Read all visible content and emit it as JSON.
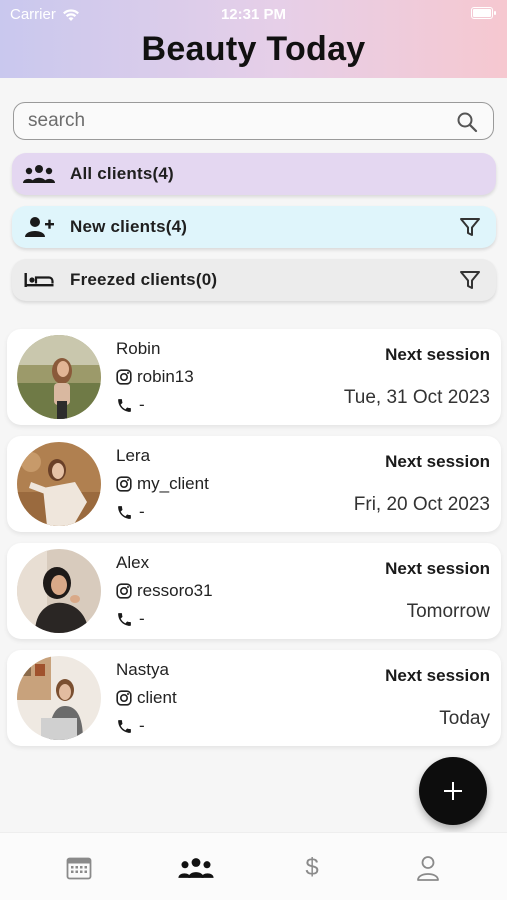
{
  "status_bar": {
    "carrier": "Carrier",
    "time": "12:31 PM"
  },
  "header": {
    "title": "Beauty Today"
  },
  "search": {
    "placeholder": "search",
    "icon": "search-icon"
  },
  "filters": [
    {
      "label": "All clients(4)",
      "icon": "group-icon",
      "has_filter": false,
      "color": "#e4d7f1"
    },
    {
      "label": "New clients(4)",
      "icon": "add-person-icon",
      "has_filter": true,
      "color": "#dff5fb"
    },
    {
      "label": "Freezed clients(0)",
      "icon": "freeze-icon",
      "has_filter": true,
      "color": "#ececec"
    }
  ],
  "clients": [
    {
      "name": "Robin",
      "instagram": "robin13",
      "phone": "-",
      "session_label": "Next session",
      "session_date": "Tue, 31 Oct 2023"
    },
    {
      "name": "Lera",
      "instagram": "my_client",
      "phone": "-",
      "session_label": "Next session",
      "session_date": "Fri, 20 Oct 2023"
    },
    {
      "name": "Alex",
      "instagram": "ressoro31",
      "phone": "-",
      "session_label": "Next session",
      "session_date": "Tomorrow"
    },
    {
      "name": "Nastya",
      "instagram": "client",
      "phone": "-",
      "session_label": "Next session",
      "session_date": "Today"
    }
  ],
  "fab": {
    "label": "+",
    "icon": "plus-icon"
  },
  "tabbar": {
    "items": [
      {
        "icon": "calendar-icon",
        "active": false
      },
      {
        "icon": "clients-icon",
        "active": true
      },
      {
        "icon": "dollar-icon",
        "label": "$",
        "active": false
      },
      {
        "icon": "profile-icon",
        "active": false
      }
    ]
  }
}
